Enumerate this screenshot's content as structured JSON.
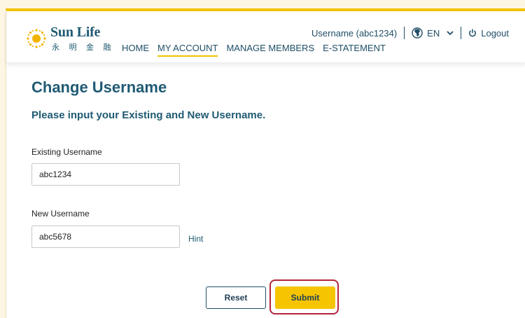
{
  "brand": {
    "name": "Sun Life",
    "subname": "永 明 金 融"
  },
  "nav": {
    "items": [
      {
        "label": "HOME",
        "active": false
      },
      {
        "label": "MY ACCOUNT",
        "active": true
      },
      {
        "label": "MANAGE MEMBERS",
        "active": false
      },
      {
        "label": "E-STATEMENT",
        "active": false
      }
    ]
  },
  "header": {
    "username": "Username (abc1234)",
    "language": "EN",
    "logout": "Logout"
  },
  "page": {
    "title": "Change Username",
    "subtitle": "Please input your Existing and New Username."
  },
  "form": {
    "existing_label": "Existing Username",
    "existing_value": "abc1234",
    "new_label": "New Username",
    "new_value": "abc5678",
    "hint": "Hint",
    "reset_label": "Reset",
    "submit_label": "Submit"
  },
  "colors": {
    "brand_blue": "#1f5a73",
    "accent_yellow": "#f2c200",
    "highlight": "#b3263a"
  }
}
